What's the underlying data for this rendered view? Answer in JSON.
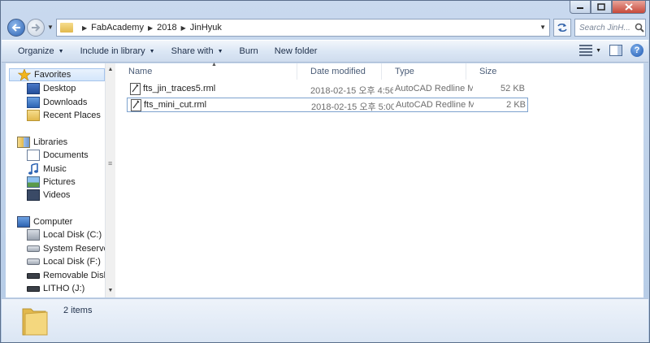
{
  "caption": {
    "minimize_icon": "minimize-icon",
    "maximize_icon": "maximize-icon",
    "close_icon": "close-icon"
  },
  "address": {
    "breadcrumbs": [
      "FabAcademy",
      "2018",
      "JinHyuk"
    ],
    "search_placeholder": "Search JinH..."
  },
  "toolbar": {
    "organize": "Organize",
    "include_in_library": "Include in library",
    "share_with": "Share with",
    "burn": "Burn",
    "new_folder": "New folder"
  },
  "nav": {
    "favorites": "Favorites",
    "desktop": "Desktop",
    "downloads": "Downloads",
    "recent_places": "Recent Places",
    "libraries": "Libraries",
    "documents": "Documents",
    "music": "Music",
    "pictures": "Pictures",
    "videos": "Videos",
    "computer": "Computer",
    "local_disk_c": "Local Disk (C:)",
    "system_reserved": "System Reserved (",
    "local_disk_f": "Local Disk (F:)",
    "removable_disk": "Removable Disk (H",
    "litho": "LITHO (J:)"
  },
  "columns": {
    "name": "Name",
    "date_modified": "Date modified",
    "type": "Type",
    "size": "Size"
  },
  "files": [
    {
      "name": "fts_jin_traces5.rml",
      "date": "2018-02-15 오후 4:56",
      "type": "AutoCAD Redline M...",
      "size": "52 KB"
    },
    {
      "name": "fts_mini_cut.rml",
      "date": "2018-02-15 오후 5:00",
      "type": "AutoCAD Redline M...",
      "size": "2 KB"
    }
  ],
  "status": {
    "item_count": "2 items"
  },
  "colors": {
    "accent": "#2c63b3",
    "chrome": "#c9d9ee",
    "selection_border": "#7da2ce"
  }
}
